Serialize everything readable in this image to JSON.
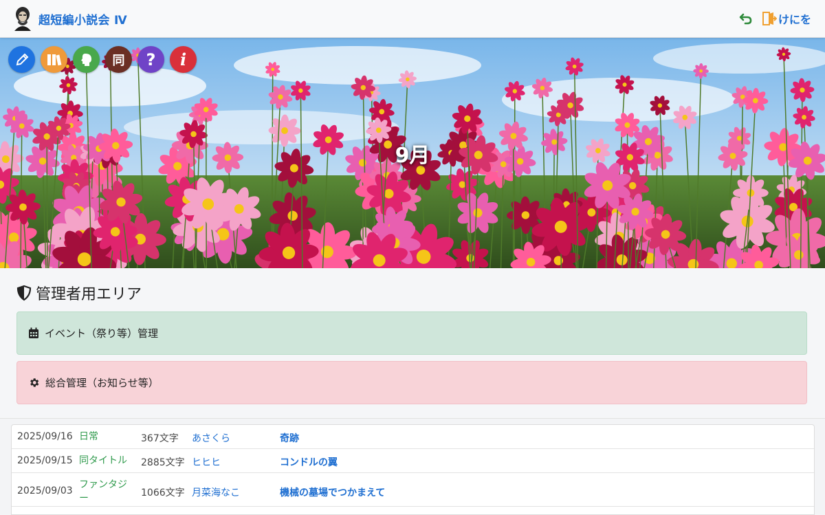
{
  "header": {
    "site_title": "超短編小説会 Ⅳ",
    "logout_label": "けにを"
  },
  "hero": {
    "title": "9月",
    "icons": [
      {
        "name": "pencil-icon",
        "color": "#1f73e0",
        "glyph": ""
      },
      {
        "name": "books-icon",
        "color": "#ef9a3a",
        "glyph": ""
      },
      {
        "name": "head-profile-icon",
        "color": "#49a84b",
        "glyph": ""
      },
      {
        "name": "same-kanji-icon",
        "color": "#6b2f24",
        "glyph": "同"
      },
      {
        "name": "question-icon",
        "color": "#6f43c7",
        "glyph": "?"
      },
      {
        "name": "info-icon",
        "color": "#d9303a",
        "glyph": "i"
      }
    ]
  },
  "admin": {
    "heading": "管理者用エリア",
    "event_label": "イベント（祭り等）管理",
    "general_label": "総合管理（お知らせ等）"
  },
  "colors": {
    "brand_blue": "#1f6fd1",
    "genre_green": "#2f9a4c",
    "panel_green": "#cfe6da",
    "panel_red": "#f8d3d8"
  },
  "posts": [
    {
      "date": "2025/09/16",
      "genre": "日常",
      "chars": "367文字",
      "author": "あさくら",
      "title": "奇跡"
    },
    {
      "date": "2025/09/15",
      "genre": "同タイトル",
      "chars": "2885文字",
      "author": "ヒヒヒ",
      "title": "コンドルの翼"
    },
    {
      "date": "2025/09/03",
      "genre": "ファンタジー",
      "chars": "1066文字",
      "author": "月菜海なこ",
      "title": "機械の墓場でつかまえて"
    }
  ]
}
